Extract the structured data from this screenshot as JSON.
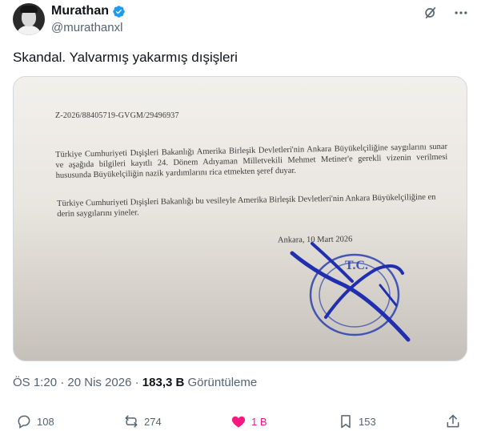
{
  "author": {
    "name": "Murathan",
    "handle": "@murathanxl",
    "verified": true,
    "verified_color": "#1d9bf0"
  },
  "header_icons": [
    "grok-icon",
    "more-icon"
  ],
  "tweet": {
    "text": "Skandal. Yalvarmış yakarmış dışişleri"
  },
  "document": {
    "ref": "Z-2026/88405719-GVGM/29496937",
    "paragraph1": "Türkiye Cumhuriyeti Dışişleri Bakanlığı Amerika Birleşik Devletleri'nin Ankara Büyükelçiliğine saygılarını sunar ve aşağıda bilgileri kayıtlı 24. Dönem Adıyaman Milletvekili Mehmet Metiner'e gerekli vizenin verilmesi hususunda Büyükelçiliğin nazik yardımlarını rica etmekten şeref duyar.",
    "paragraph2": "Türkiye Cumhuriyeti Dışişleri Bakanlığı bu vesileyle Amerika Birleşik Devletleri'nin Ankara Büyükelçiliğine en derin saygılarını yineler.",
    "date": "Ankara, 10 Mart 2026",
    "stamp_text": "T.C."
  },
  "meta": {
    "time": "ÖS 1:20",
    "sep1": "·",
    "date": "20 Nis 2026",
    "sep2": "·",
    "views": "183,3 B",
    "views_label": "Görüntüleme"
  },
  "actions": {
    "replies": "108",
    "reposts": "274",
    "likes": "1 B",
    "bookmarks": "153",
    "like_color": "#f91880",
    "icon_color": "#536471"
  }
}
